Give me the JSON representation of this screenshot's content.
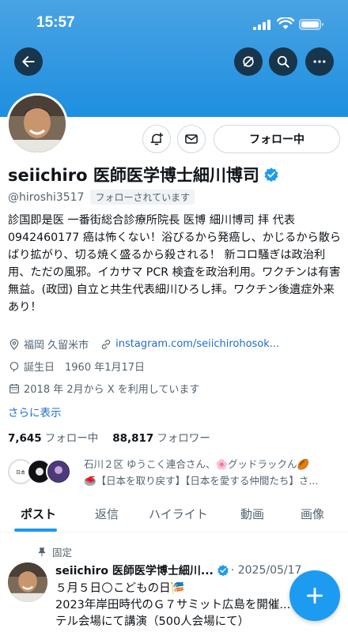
{
  "status_bar": {
    "time": "15:57"
  },
  "profile": {
    "name": "seiichiro 医師医学博士細川博司",
    "handle": "@hiroshi3517",
    "follows_you": "フォローされています",
    "follow_button": "フォロー中",
    "bio": "診国即是医 一番街総合診療所院長 医博 細川博司 拝 代表0942460177 癌は怖くない！浴びるから発癌し、かじるから散らばり拡がり、切る焼く盛るから殺される！ 新コロ騒ぎは政治利用、ただの風邪。イカサマ PCR 検査を政治利用。ワクチンは有害無益。(政団) 自立と共生代表細川ひろし拝。ワクチン後遺症外来あり！",
    "location": "福岡 久留米市",
    "website": "instagram.com/seiichirohosok...",
    "birthday": "誕生日　1960 年1月17日",
    "joined": "2018 年 2月から X を利用しています",
    "show_more": "さらに表示",
    "following_count": "7,645",
    "following_label": "フォロー中",
    "followers_count": "88,817",
    "followers_label": "フォロワー",
    "followed_by_line1": "石川２区 ゆうこく連合さん、🌸グッドラックん🏉",
    "followed_by_line2": "🥌【日本を取り戻す】【日本を愛する仲間たち】さ..."
  },
  "tabs": [
    {
      "label": "ポスト"
    },
    {
      "label": "返信"
    },
    {
      "label": "ハイライト"
    },
    {
      "label": "動画"
    },
    {
      "label": "画像"
    }
  ],
  "pinned_post": {
    "pinned_label": "固定",
    "author": "seiichiro 医師医学博士細川...",
    "date": "· 2025/05/17",
    "line1": "５月５日🌕こどもの日🎏",
    "line2": "2023年岸田時代のＧ７サミット広島を開催...",
    "line3": "テル会場にて講演（500人会場にて）"
  },
  "colors": {
    "accent": "#1d9bf0",
    "banner": "#1d8fe0",
    "link": "#1d6fc4"
  },
  "icons": [
    "back-arrow-icon",
    "retweet-icon",
    "search-icon",
    "more-icon",
    "notify-bell-icon",
    "mail-icon",
    "verified-icon",
    "location-icon",
    "link-icon",
    "birthday-icon",
    "calendar-icon",
    "pin-icon",
    "compose-plus-icon"
  ]
}
